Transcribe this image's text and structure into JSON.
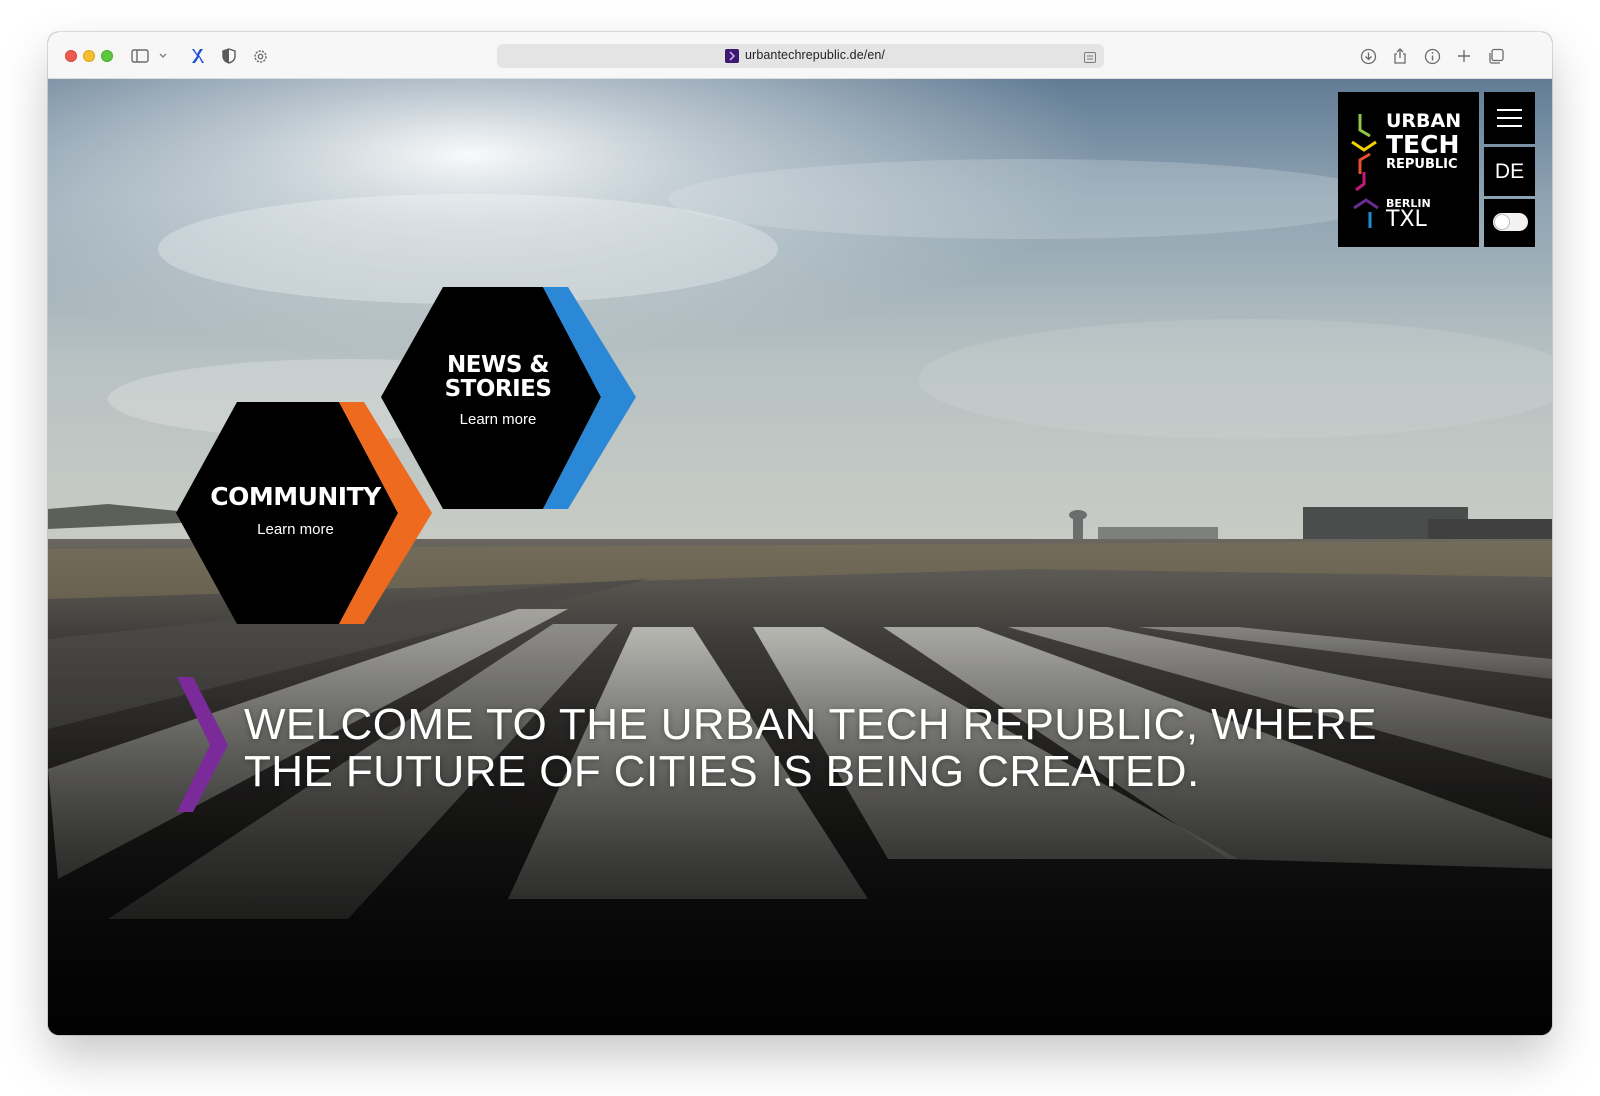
{
  "browser": {
    "url": "urbantechrepublic.de/en/",
    "icons": [
      "sidebar-icon",
      "chevron-down-icon",
      "extension-icon",
      "shield-icon",
      "gear-icon",
      "download-icon",
      "share-icon",
      "info-icon",
      "plus-icon",
      "tabs-icon"
    ]
  },
  "logo": {
    "line1": "URBAN",
    "line2": "TECH",
    "line3": "REPUBLIC",
    "line4": "BERLIN",
    "line5": "TXL",
    "colors": [
      "#8dc63f",
      "#f5d000",
      "#e8502a",
      "#c2187a",
      "#6a2c91",
      "#1e8fd5"
    ]
  },
  "nav": {
    "language": "DE"
  },
  "tiles": [
    {
      "title_line1": "NEWS &",
      "title_line2": "STORIES",
      "link": "Learn more",
      "accent": "#2a88d6"
    },
    {
      "title_line1": "COMMUNITY",
      "link": "Learn more",
      "accent": "#ee6a1f"
    }
  ],
  "hero": {
    "line1": "WELCOME TO THE URBAN TECH REPUBLIC, WHERE",
    "line2": "THE FUTURE OF CITIES IS BEING CREATED.",
    "accent": "#7b2a9a"
  }
}
